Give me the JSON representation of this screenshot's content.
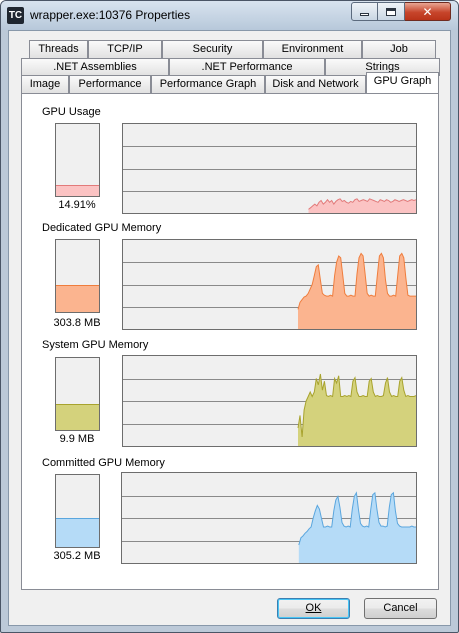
{
  "window": {
    "app_icon_text": "TC",
    "title": "wrapper.exe:10376 Properties",
    "close_glyph": "✕"
  },
  "tabs": {
    "row1": [
      "Threads",
      "TCP/IP",
      "Security",
      "Environment",
      "Job"
    ],
    "row2": [
      ".NET Assemblies",
      ".NET Performance",
      "Strings"
    ],
    "row3": [
      "Image",
      "Performance",
      "Performance Graph",
      "Disk and Network",
      "GPU Graph"
    ],
    "active": "GPU Graph"
  },
  "graphs": [
    {
      "label": "GPU Usage",
      "value": "14.91%",
      "fraction": 0.15,
      "fill": "#fbc3c3",
      "stroke": "#e27a7a",
      "grid_lines": 3,
      "samples": [
        0,
        0,
        0,
        0,
        0,
        0,
        0,
        0,
        0,
        0,
        0,
        0,
        0,
        0,
        0,
        0,
        0,
        0,
        0,
        0,
        0,
        0,
        0,
        0,
        0,
        0,
        0,
        0,
        0,
        0,
        0,
        0,
        0,
        0,
        0,
        0,
        0,
        0,
        0,
        0,
        0,
        0,
        0,
        0,
        0,
        0,
        0,
        0,
        0,
        0,
        0,
        0,
        0,
        0,
        0,
        0,
        0,
        0,
        0,
        0,
        0,
        0,
        0,
        0,
        0,
        0,
        0,
        0,
        0,
        0,
        0,
        0,
        0,
        0,
        0,
        0,
        0,
        0,
        0,
        0,
        0,
        0,
        0,
        0,
        0,
        0,
        0,
        0,
        0.04,
        0.06,
        0.08,
        0.1,
        0.08,
        0.12,
        0.14,
        0.1,
        0.12,
        0.15,
        0.12,
        0.14,
        0.1,
        0.13,
        0.15,
        0.16,
        0.13,
        0.14,
        0.12,
        0.11,
        0.13,
        0.12,
        0.15,
        0.16,
        0.13,
        0.14,
        0.15,
        0.14,
        0.13,
        0.16,
        0.15,
        0.14,
        0.13,
        0.12,
        0.15,
        0.14,
        0.13,
        0.15,
        0.14,
        0.12,
        0.13,
        0.15,
        0.14,
        0.13,
        0.14,
        0.15,
        0.14,
        0.13,
        0.14,
        0.15,
        0.14,
        0.15
      ]
    },
    {
      "label": "Dedicated GPU Memory",
      "value": "303.8 MB",
      "fraction": 0.37,
      "fill": "#fbb48f",
      "stroke": "#ef7d3d",
      "grid_lines": 3,
      "samples": [
        0,
        0,
        0,
        0,
        0,
        0,
        0,
        0,
        0,
        0,
        0,
        0,
        0,
        0,
        0,
        0,
        0,
        0,
        0,
        0,
        0,
        0,
        0,
        0,
        0,
        0,
        0,
        0,
        0,
        0,
        0,
        0,
        0,
        0,
        0,
        0,
        0,
        0,
        0,
        0,
        0,
        0,
        0,
        0,
        0,
        0,
        0,
        0,
        0,
        0,
        0,
        0,
        0,
        0,
        0,
        0,
        0,
        0,
        0,
        0,
        0,
        0,
        0,
        0,
        0,
        0,
        0,
        0,
        0,
        0,
        0,
        0,
        0,
        0,
        0,
        0,
        0,
        0,
        0,
        0,
        0,
        0,
        0,
        0,
        0,
        0,
        0.22,
        0.3,
        0.33,
        0.36,
        0.37,
        0.4,
        0.45,
        0.5,
        0.6,
        0.7,
        0.72,
        0.55,
        0.4,
        0.38,
        0.37,
        0.37,
        0.38,
        0.37,
        0.6,
        0.75,
        0.82,
        0.8,
        0.6,
        0.4,
        0.37,
        0.37,
        0.38,
        0.37,
        0.37,
        0.62,
        0.8,
        0.85,
        0.82,
        0.62,
        0.4,
        0.37,
        0.38,
        0.37,
        0.37,
        0.6,
        0.82,
        0.85,
        0.8,
        0.55,
        0.4,
        0.37,
        0.37,
        0.38,
        0.37,
        0.6,
        0.82,
        0.85,
        0.8,
        0.58,
        0.38,
        0.37,
        0.37,
        0.37,
        0.37
      ]
    },
    {
      "label": "System GPU Memory",
      "value": "9.9 MB",
      "fraction": 0.36,
      "fill": "#d4d27c",
      "stroke": "#a8a32e",
      "grid_lines": 3,
      "samples": [
        0,
        0,
        0,
        0,
        0,
        0,
        0,
        0,
        0,
        0,
        0,
        0,
        0,
        0,
        0,
        0,
        0,
        0,
        0,
        0,
        0,
        0,
        0,
        0,
        0,
        0,
        0,
        0,
        0,
        0,
        0,
        0,
        0,
        0,
        0,
        0,
        0,
        0,
        0,
        0,
        0,
        0,
        0,
        0,
        0,
        0,
        0,
        0,
        0,
        0,
        0,
        0,
        0,
        0,
        0,
        0,
        0,
        0,
        0,
        0,
        0,
        0,
        0,
        0,
        0,
        0,
        0,
        0,
        0,
        0,
        0,
        0,
        0,
        0,
        0,
        0,
        0,
        0,
        0,
        0,
        0,
        0,
        0,
        0,
        0,
        0,
        0.2,
        0.34,
        0.1,
        0.4,
        0.5,
        0.55,
        0.6,
        0.55,
        0.6,
        0.75,
        0.68,
        0.8,
        0.62,
        0.72,
        0.56,
        0.55,
        0.56,
        0.55,
        0.75,
        0.7,
        0.78,
        0.55,
        0.55,
        0.56,
        0.55,
        0.56,
        0.55,
        0.72,
        0.76,
        0.6,
        0.55,
        0.55,
        0.56,
        0.55,
        0.55,
        0.72,
        0.75,
        0.6,
        0.55,
        0.56,
        0.55,
        0.55,
        0.56,
        0.7,
        0.76,
        0.6,
        0.55,
        0.56,
        0.55,
        0.55,
        0.72,
        0.76,
        0.62,
        0.55,
        0.56,
        0.55,
        0.55,
        0.55,
        0.56
      ]
    },
    {
      "label": "Committed GPU Memory",
      "value": "305.2 MB",
      "fraction": 0.4,
      "fill": "#b5dbf7",
      "stroke": "#5aa6de",
      "grid_lines": 3,
      "samples": [
        0,
        0,
        0,
        0,
        0,
        0,
        0,
        0,
        0,
        0,
        0,
        0,
        0,
        0,
        0,
        0,
        0,
        0,
        0,
        0,
        0,
        0,
        0,
        0,
        0,
        0,
        0,
        0,
        0,
        0,
        0,
        0,
        0,
        0,
        0,
        0,
        0,
        0,
        0,
        0,
        0,
        0,
        0,
        0,
        0,
        0,
        0,
        0,
        0,
        0,
        0,
        0,
        0,
        0,
        0,
        0,
        0,
        0,
        0,
        0,
        0,
        0,
        0,
        0,
        0,
        0,
        0,
        0,
        0,
        0,
        0,
        0,
        0,
        0,
        0,
        0,
        0,
        0,
        0,
        0,
        0,
        0,
        0,
        0,
        0,
        0,
        0.2,
        0.28,
        0.3,
        0.33,
        0.35,
        0.38,
        0.4,
        0.5,
        0.58,
        0.64,
        0.6,
        0.5,
        0.4,
        0.4,
        0.41,
        0.4,
        0.4,
        0.58,
        0.7,
        0.74,
        0.62,
        0.45,
        0.41,
        0.4,
        0.41,
        0.4,
        0.6,
        0.74,
        0.78,
        0.6,
        0.44,
        0.41,
        0.4,
        0.41,
        0.4,
        0.6,
        0.76,
        0.78,
        0.6,
        0.45,
        0.41,
        0.41,
        0.4,
        0.41,
        0.62,
        0.76,
        0.78,
        0.58,
        0.44,
        0.41,
        0.4,
        0.4,
        0.4,
        0.4,
        0.4,
        0.41,
        0.4,
        0.4
      ]
    }
  ],
  "buttons": {
    "ok_label": "OK",
    "cancel_label": "Cancel"
  }
}
